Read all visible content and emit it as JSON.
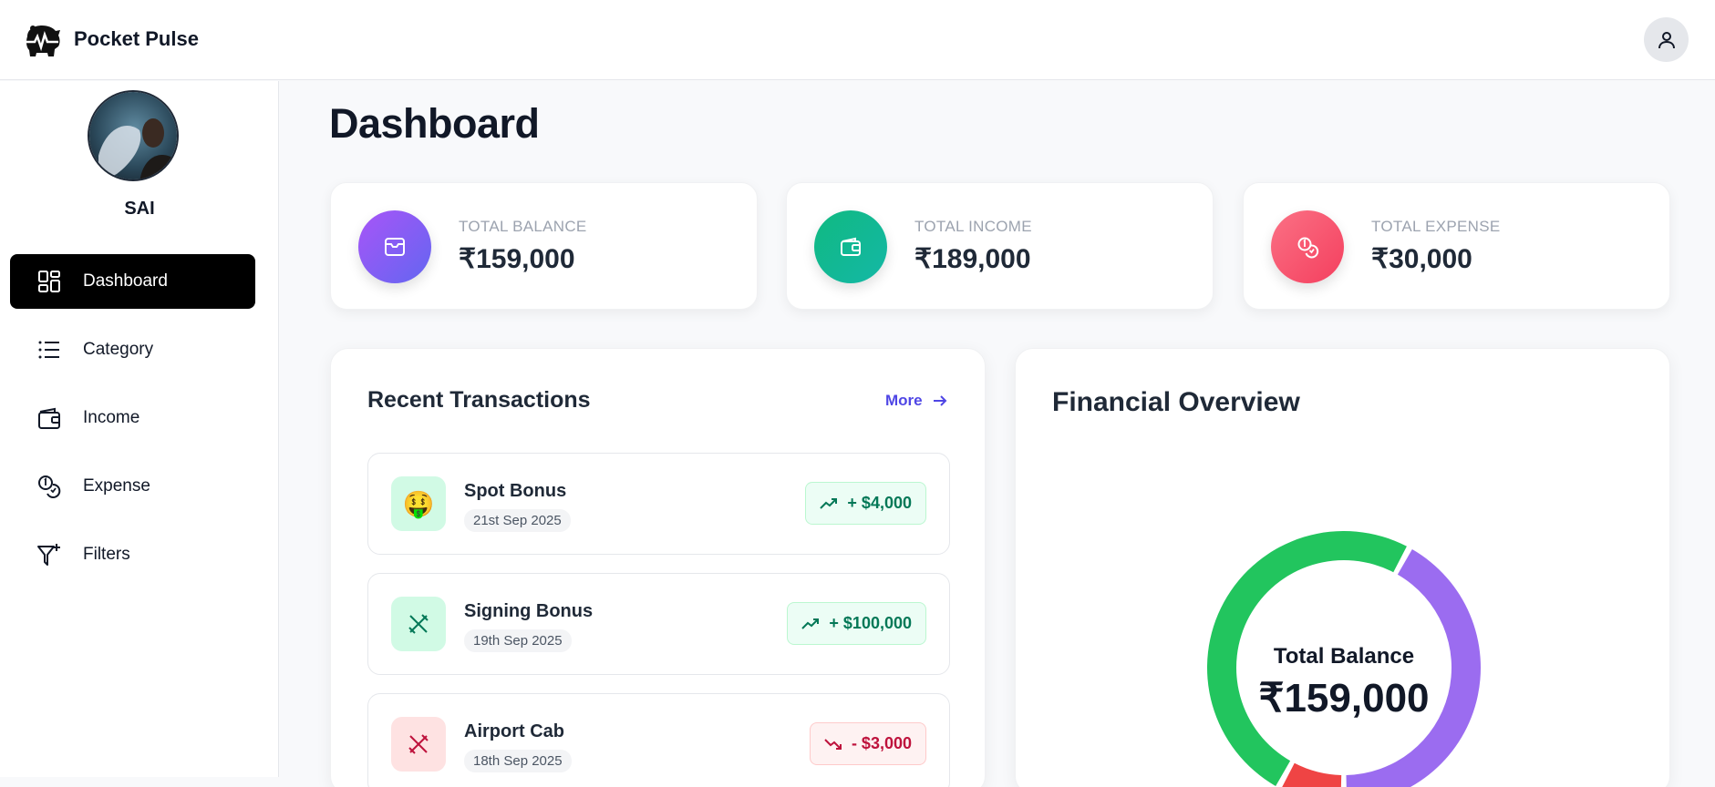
{
  "app": {
    "name": "Pocket Pulse"
  },
  "icons": {
    "logo": "piggy-bank-pulse-icon",
    "account": "user-icon",
    "dashboard": "grid-icon",
    "category": "list-icon",
    "income": "wallet-icon",
    "expense": "coins-icon",
    "filters": "filter-plus-icon"
  },
  "sidebar": {
    "user_name": "SAI",
    "items": [
      {
        "label": "Dashboard",
        "active": true
      },
      {
        "label": "Category",
        "active": false
      },
      {
        "label": "Income",
        "active": false
      },
      {
        "label": "Expense",
        "active": false
      },
      {
        "label": "Filters",
        "active": false
      }
    ]
  },
  "main": {
    "title": "Dashboard",
    "stats": [
      {
        "label": "TOTAL BALANCE",
        "value": "₹159,000",
        "color": "#7c3aed"
      },
      {
        "label": "TOTAL INCOME",
        "value": "₹189,000",
        "color": "#10b981"
      },
      {
        "label": "TOTAL EXPENSE",
        "value": "₹30,000",
        "color": "#f43f5e"
      }
    ],
    "recent": {
      "title": "Recent Transactions",
      "more_label": "More",
      "items": [
        {
          "name": "Spot Bonus",
          "date": "21st Sep 2025",
          "amount": "+ $4,000",
          "type": "income",
          "icon": "money-face-emoji"
        },
        {
          "name": "Signing Bonus",
          "date": "19th Sep 2025",
          "amount": "+ $100,000",
          "type": "income",
          "icon": "utensils-icon"
        },
        {
          "name": "Airport Cab",
          "date": "18th Sep 2025",
          "amount": "- $3,000",
          "type": "expense",
          "icon": "utensils-icon"
        }
      ]
    },
    "overview": {
      "title": "Financial Overview",
      "center_label": "Total Balance",
      "center_value": "₹159,000"
    }
  },
  "chart_data": {
    "type": "pie",
    "categories": [
      "Total Balance",
      "Total Expense",
      "Total Income"
    ],
    "values": [
      159000,
      30000,
      189000
    ],
    "colors": [
      "#9b6cf0",
      "#ef4444",
      "#22c55e"
    ]
  }
}
